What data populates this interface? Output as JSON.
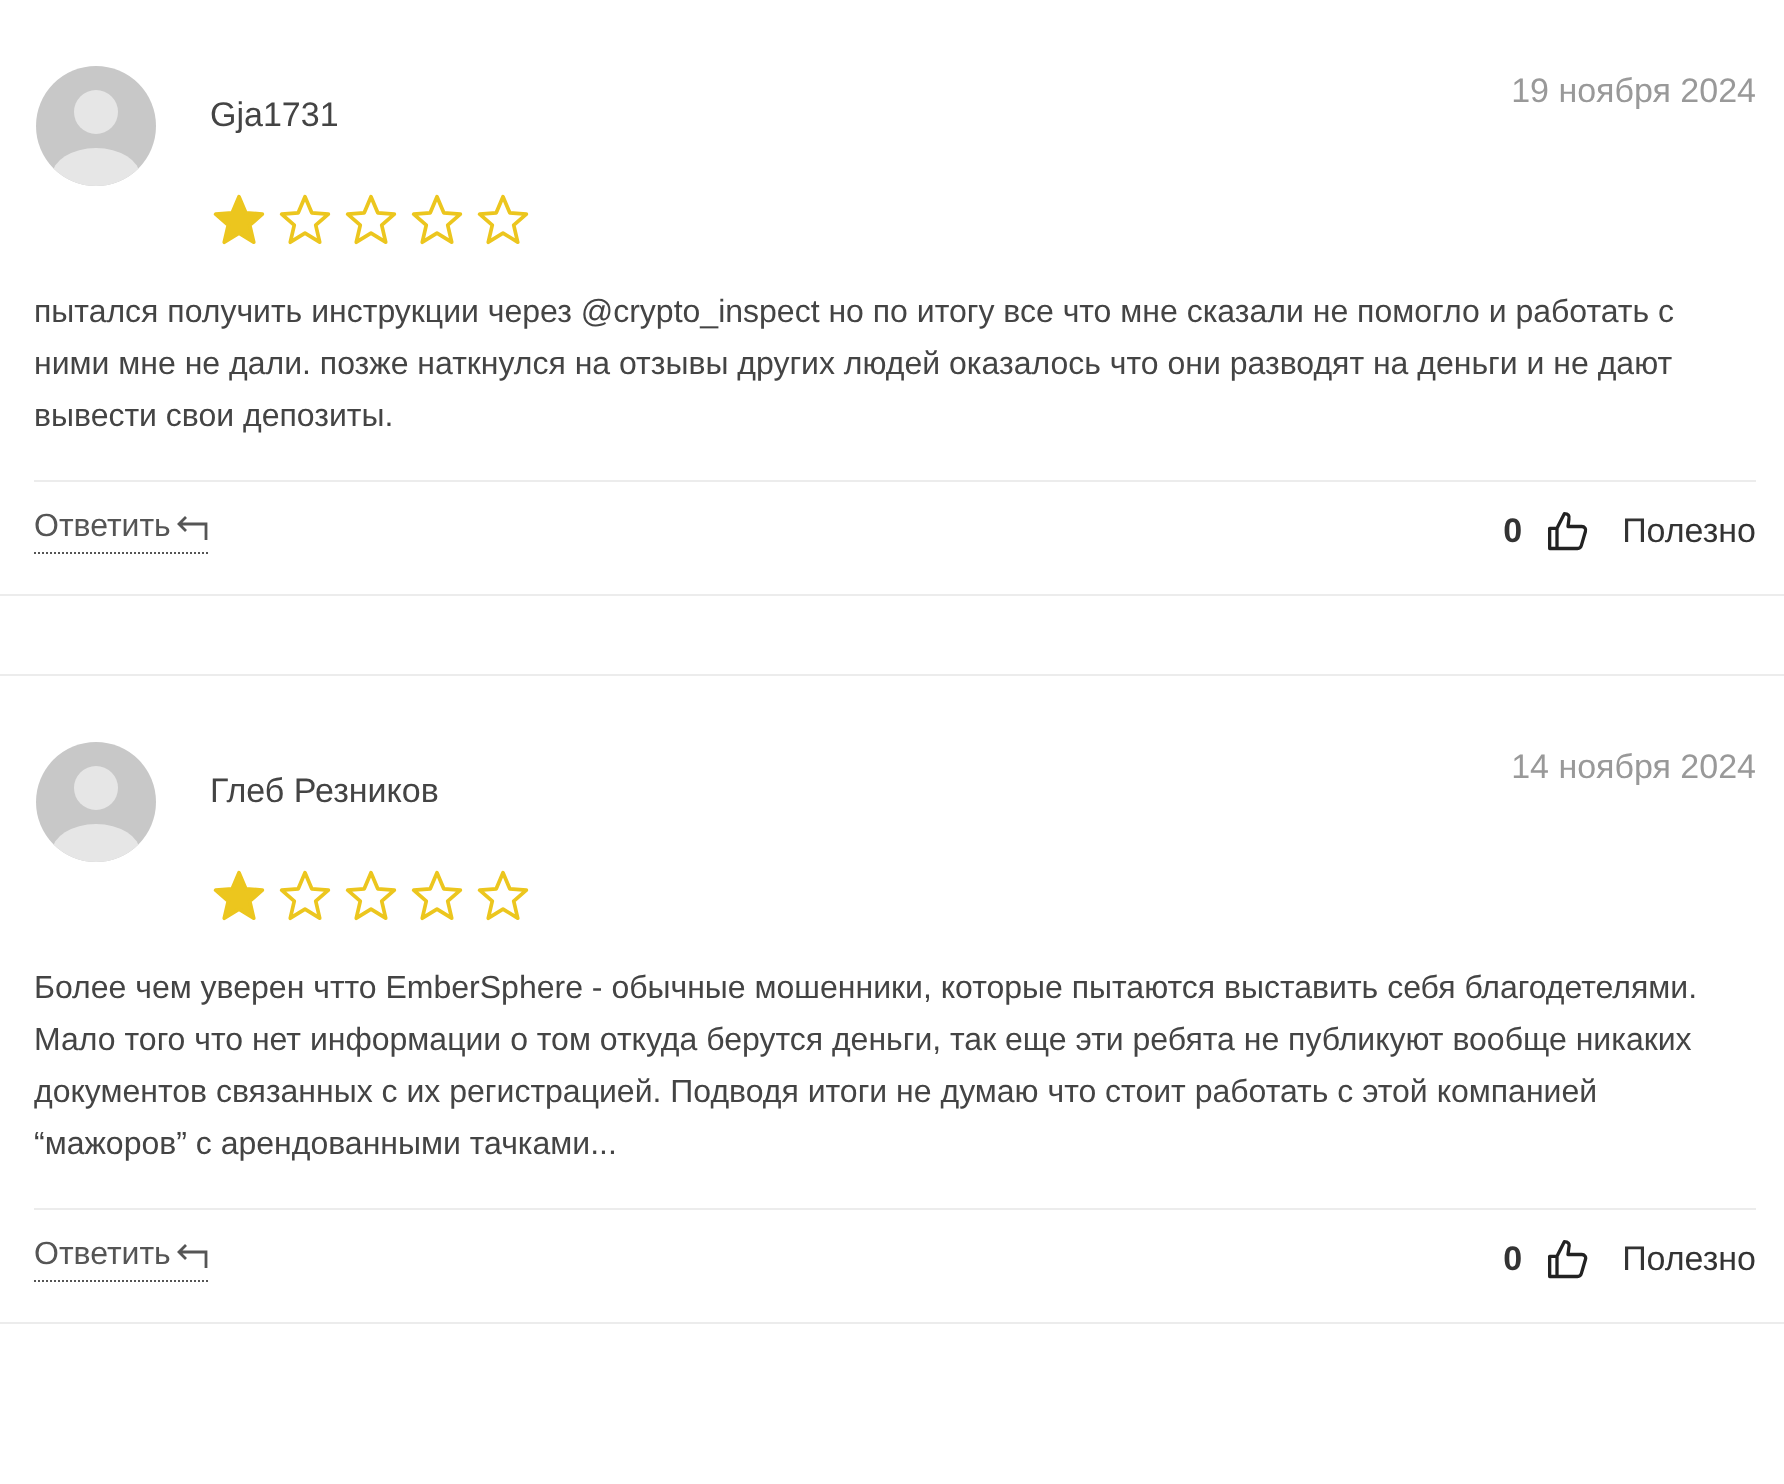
{
  "reviews": [
    {
      "author": "Gja1731",
      "date": "19 ноября 2024",
      "stars": 1,
      "text": "пытался получить инструкции через @crypto_inspect но по итогу все что мне сказали не помогло и работать с ними мне не дали. позже наткнулся на отзывы других людей оказалось что они разводят на деньги и не дают вывести свои депозиты.",
      "reply": "Ответить",
      "likes": "0",
      "helpful": "Полезно"
    },
    {
      "author": "Глеб Резников",
      "date": "14 ноября 2024",
      "stars": 1,
      "text": "Более чем уверен чтто EmberSphere - обычные мошенники, которые пытаются выставить себя благодетелями. Мало того что нет информации о том откуда берутся деньги, так еще эти ребята не публикуют вообще никаких документов связанных с их регистрацией. Подводя итоги не думаю что стоит работать с этой компанией “мажоров” с арендованными тачками...",
      "reply": "Ответить",
      "likes": "0",
      "helpful": "Полезно"
    }
  ]
}
